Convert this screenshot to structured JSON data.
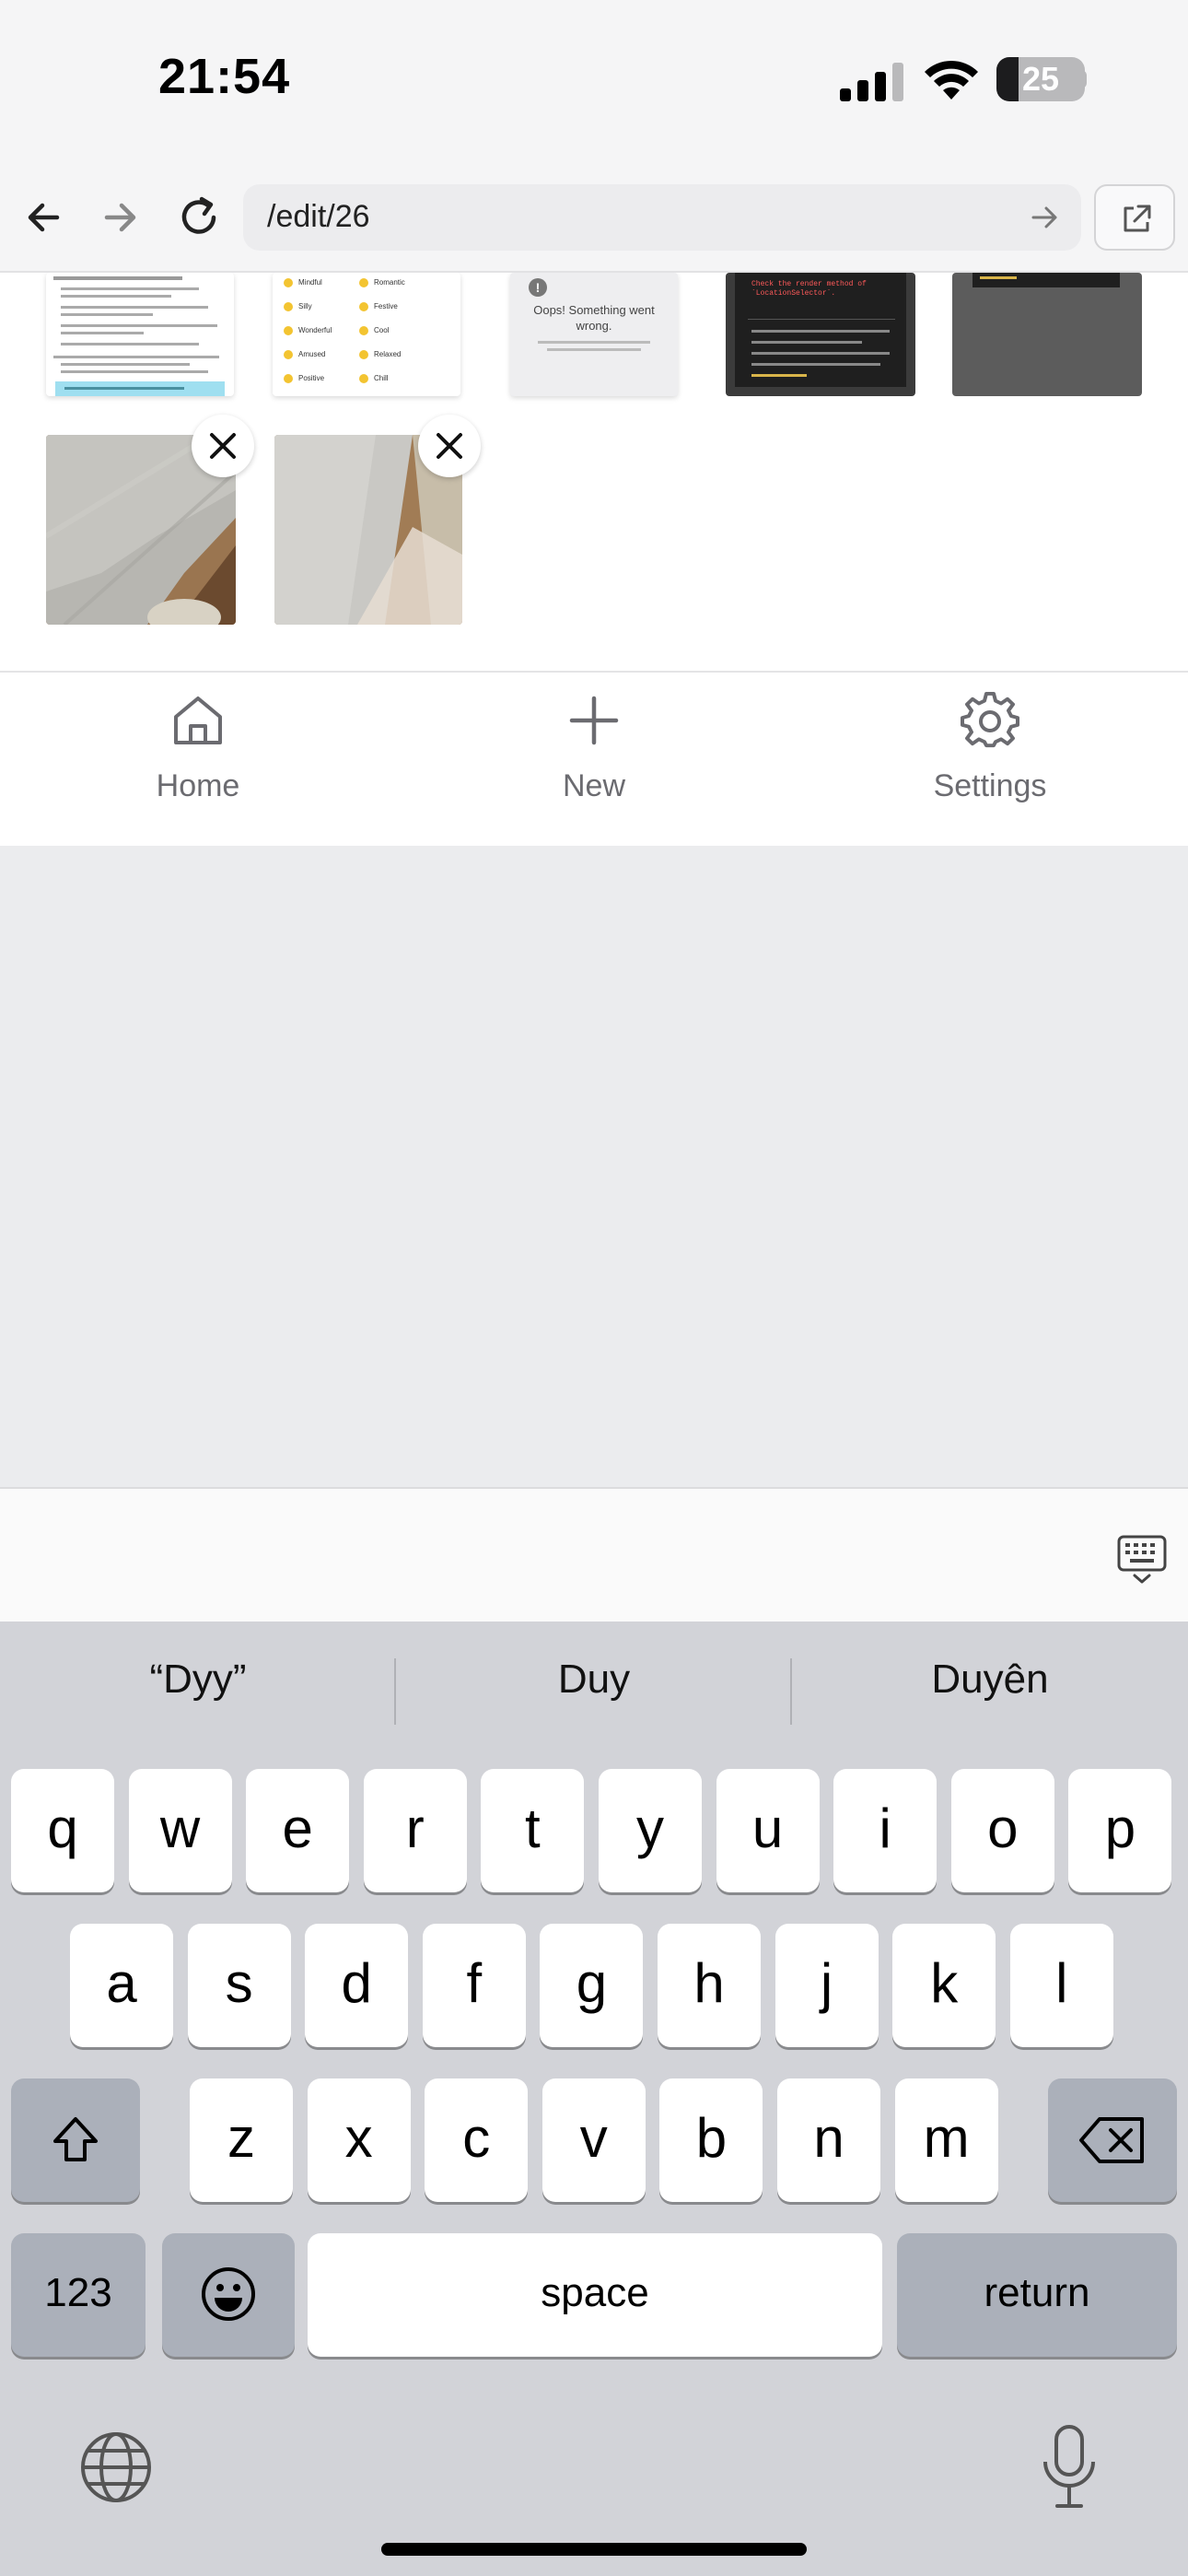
{
  "status_bar": {
    "time": "21:54",
    "battery_level": 25,
    "battery_label": "25"
  },
  "browser": {
    "url": "/edit/26"
  },
  "gallery": {
    "thumb_top_2_items": [
      "Mindful",
      "Romantic",
      "Silly",
      "Festive",
      "Wonderful",
      "Cool",
      "Amused",
      "Relaxed",
      "Positive",
      "Chill"
    ],
    "thumb_top_3_text": "Oops! Something went wrong.",
    "thumb_top_4_text": "Check the render method of `LocationSelector`."
  },
  "tab_nav": {
    "items": [
      {
        "label": "Home",
        "icon": "home-icon"
      },
      {
        "label": "New",
        "icon": "plus-icon"
      },
      {
        "label": "Settings",
        "icon": "gear-icon"
      }
    ]
  },
  "keyboard": {
    "suggestions": [
      "“Dyy”",
      "Duy",
      "Duyên"
    ],
    "row1": [
      "q",
      "w",
      "e",
      "r",
      "t",
      "y",
      "u",
      "i",
      "o",
      "p"
    ],
    "row2": [
      "a",
      "s",
      "d",
      "f",
      "g",
      "h",
      "j",
      "k",
      "l"
    ],
    "row3": [
      "z",
      "x",
      "c",
      "v",
      "b",
      "n",
      "m"
    ],
    "numbers_label": "123",
    "space_label": "space",
    "return_label": "return"
  }
}
